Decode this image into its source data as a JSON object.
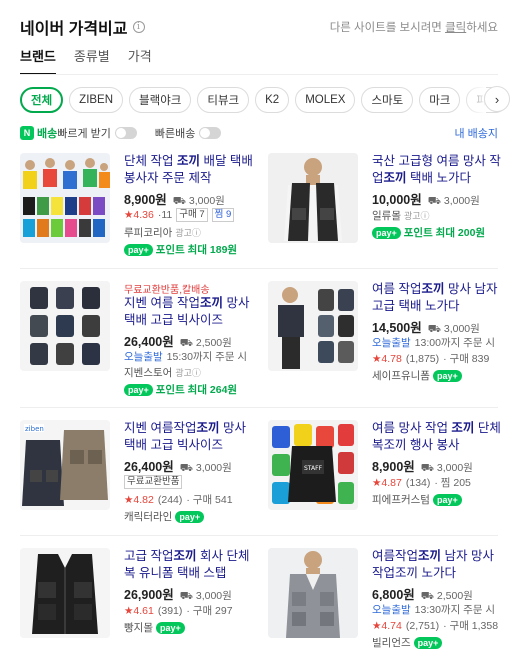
{
  "header": {
    "title": "네이버 가격비교",
    "info": "i",
    "right_prefix": "다른 사이트를 보시려면 ",
    "right_link": "클릭",
    "right_suffix": "하세요"
  },
  "tabs": [
    {
      "label": "브랜드"
    },
    {
      "label": "종류별"
    },
    {
      "label": "가격"
    }
  ],
  "chips": [
    {
      "label": "전체"
    },
    {
      "label": "ZIBEN"
    },
    {
      "label": "블랙야크"
    },
    {
      "label": "티뷰크"
    },
    {
      "label": "K2"
    },
    {
      "label": "MOLEX"
    },
    {
      "label": "스마토"
    },
    {
      "label": "마크"
    },
    {
      "label": "파브"
    }
  ],
  "chip_next": "›",
  "filters": {
    "npay_icon": "N",
    "npay_label": "배송",
    "fast_label": " 빠르게 받기",
    "quick_label": "빠른배송",
    "my_delivery": "내 배송지"
  },
  "products": [
    {
      "title_pre": "단체 작업 ",
      "title_bold": "조끼",
      "title_post": " 배달 택배 봉사자 주문 제작",
      "price": "8,900원",
      "shipping": "⛟ 3,000원",
      "rating": "★4.36",
      "reviews": "·11",
      "tag1": "구매 7",
      "tag2": "찜 9",
      "store": "루피코리아",
      "ad": "광고ⓘ",
      "pay": "pay+",
      "point": "포인트 최대 189원"
    },
    {
      "title_pre": "국산 고급형 여름 망사 작업",
      "title_bold": "조끼",
      "title_post": " 택배 노가다",
      "price": "10,000원",
      "shipping": "⛟ 3,000원",
      "store": "일류몰",
      "ad": "광고ⓘ",
      "pay": "pay+",
      "point": "포인트 최대 200원"
    },
    {
      "promo": "무료교환반품,칼배송",
      "title_pre": "지벤 여름 작업",
      "title_bold": "조끼",
      "title_post": " 망사 택배 고급 빅사이즈",
      "price": "26,400원",
      "shipping": "⛟ 2,500원",
      "today": "오늘출발",
      "today_detail": "15:30까지 주문 시",
      "store": "지벤스토어",
      "ad": "광고ⓘ",
      "pay": "pay+",
      "point": "포인트 최대 264원"
    },
    {
      "title_pre": "여름 작업",
      "title_bold": "조끼",
      "title_post": " 망사 남자 고급 택배 노가다",
      "price": "14,500원",
      "shipping": "⛟ 3,000원",
      "today": "오늘출발",
      "today_detail": "13:00까지 주문 시",
      "rating": "★4.78",
      "reviews": "(1,875)",
      "buy": "· 구매 839",
      "store": "세이프유니폼",
      "pay": "pay+"
    },
    {
      "title_pre": "지벤 여름작업",
      "title_bold": "조끼",
      "title_post": " 망사 택배 고급 빅사이즈",
      "price": "26,400원",
      "shipping": "⛟ 3,000원",
      "tag1": "무료교환반품",
      "rating": "★4.82",
      "reviews": "(244)",
      "buy": "· 구매 541",
      "store": "캐릭터라인",
      "pay": "pay+"
    },
    {
      "title_pre": "여름 망사 작업 ",
      "title_bold": "조끼",
      "title_post": " 단체복조끼 행사 봉사",
      "price": "8,900원",
      "shipping": "⛟ 3,000원",
      "rating": "★4.87",
      "reviews": "(134)",
      "buy": "· 찜 205",
      "store": "피에프커스텀",
      "pay": "pay+"
    },
    {
      "title_pre": "고급 작업",
      "title_bold": "조끼",
      "title_post": " 회사 단체복 유니폼 택배 스탭",
      "price": "26,900원",
      "shipping": "⛟ 3,000원",
      "rating": "★4.61",
      "reviews": "(391)",
      "buy": "· 구매 297",
      "store": "빵지몰",
      "pay": "pay+"
    },
    {
      "title_pre": "여름작업",
      "title_bold": "조끼",
      "title_post": " 남자 망사작업조끼 노가다",
      "price": "6,800원",
      "shipping": "⛟ 2,500원",
      "today": "오늘출발",
      "today_detail": "13:30까지 주문 시",
      "rating": "★4.74",
      "reviews": "(2,751)",
      "buy": "· 구매 1,358",
      "store": "빌리언즈",
      "pay": "pay+"
    }
  ]
}
